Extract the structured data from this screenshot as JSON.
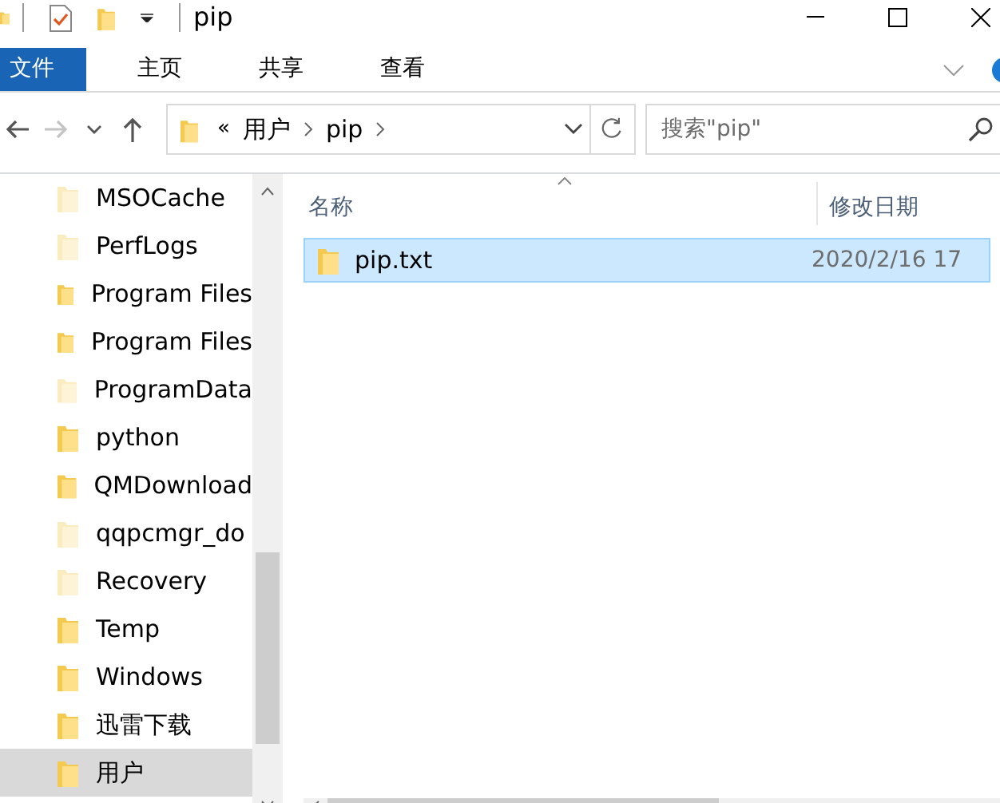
{
  "title_bar": {
    "title": "pip"
  },
  "ribbon_tabs": [
    {
      "label": "文件",
      "selected": true
    },
    {
      "label": "主页",
      "selected": false
    },
    {
      "label": "共享",
      "selected": false
    },
    {
      "label": "查看",
      "selected": false
    }
  ],
  "navigation": [
    {
      "kind": "back",
      "disabled": false
    },
    {
      "kind": "forward",
      "disabled": true
    },
    {
      "kind": "recent",
      "disabled": false
    },
    {
      "kind": "up",
      "disabled": false
    }
  ],
  "address_bar": {
    "overflow": "«",
    "path": [
      "用户",
      "pip"
    ]
  },
  "search": {
    "placeholder": "搜索\"pip\""
  },
  "sidebar": {
    "items": [
      {
        "label": "MSOCache",
        "hidden": true,
        "selected": false
      },
      {
        "label": "PerfLogs",
        "hidden": true,
        "selected": false
      },
      {
        "label": "Program Files",
        "hidden": false,
        "selected": false
      },
      {
        "label": "Program Files",
        "hidden": false,
        "selected": false
      },
      {
        "label": "ProgramData",
        "hidden": true,
        "selected": false
      },
      {
        "label": "python",
        "hidden": false,
        "selected": false
      },
      {
        "label": "QMDownload",
        "hidden": false,
        "selected": false
      },
      {
        "label": "qqpcmgr_do",
        "hidden": true,
        "selected": false
      },
      {
        "label": "Recovery",
        "hidden": true,
        "selected": false
      },
      {
        "label": "Temp",
        "hidden": false,
        "selected": false
      },
      {
        "label": "Windows",
        "hidden": false,
        "selected": false
      },
      {
        "label": "迅雷下载",
        "hidden": false,
        "selected": false
      },
      {
        "label": "用户",
        "hidden": false,
        "selected": true
      }
    ]
  },
  "file_list": {
    "columns": [
      {
        "label": "名称",
        "sorted": true
      },
      {
        "label": "修改日期",
        "sorted": false
      }
    ],
    "rows": [
      {
        "name": "pip.txt",
        "modified": "2020/2/16 17",
        "selected": true
      }
    ]
  }
}
